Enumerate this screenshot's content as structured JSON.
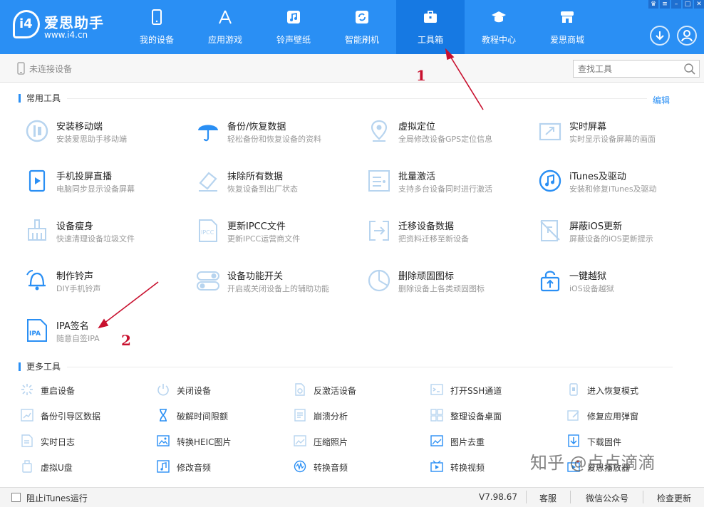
{
  "app": {
    "logo_name": "爱思助手",
    "logo_url": "www.i4.cn",
    "logo_badge": "i4",
    "accent": "#2a8ff4",
    "active_nav_bg": "#1679e3"
  },
  "nav": [
    {
      "label": "我的设备",
      "icon": "phone-icon"
    },
    {
      "label": "应用游戏",
      "icon": "app-store-icon"
    },
    {
      "label": "铃声壁纸",
      "icon": "music-icon"
    },
    {
      "label": "智能刷机",
      "icon": "refresh-icon"
    },
    {
      "label": "工具箱",
      "icon": "toolbox-icon",
      "active": true
    },
    {
      "label": "教程中心",
      "icon": "graduation-cap-icon"
    },
    {
      "label": "爱思商城",
      "icon": "store-icon"
    }
  ],
  "device_status": "未连接设备",
  "search": {
    "placeholder": "查找工具"
  },
  "common_tools": {
    "title": "常用工具",
    "edit": "编辑",
    "items": [
      {
        "name": "安装移动端",
        "desc": "安装爱思助手移动端",
        "icon": "install-mobile-icon"
      },
      {
        "name": "备份/恢复数据",
        "desc": "轻松备份和恢复设备的资料",
        "icon": "umbrella-icon"
      },
      {
        "name": "虚拟定位",
        "desc": "全局修改设备GPS定位信息",
        "icon": "location-pin-icon"
      },
      {
        "name": "实时屏幕",
        "desc": "实时显示设备屏幕的画面",
        "icon": "screen-icon"
      },
      {
        "name": "手机投屏直播",
        "desc": "电脑同步显示设备屏幕",
        "icon": "play-screen-icon"
      },
      {
        "name": "抹除所有数据",
        "desc": "恢复设备到出厂状态",
        "icon": "eraser-icon"
      },
      {
        "name": "批量激活",
        "desc": "支持多台设备同时进行激活",
        "icon": "batch-activate-icon"
      },
      {
        "name": "iTunes及驱动",
        "desc": "安装和修复iTunes及驱动",
        "icon": "itunes-icon"
      },
      {
        "name": "设备瘦身",
        "desc": "快速清理设备垃圾文件",
        "icon": "broom-icon"
      },
      {
        "name": "更新IPCC文件",
        "desc": "更新IPCC运营商文件",
        "icon": "ipcc-file-icon"
      },
      {
        "name": "迁移设备数据",
        "desc": "把资料迁移至新设备",
        "icon": "migrate-icon"
      },
      {
        "name": "屏蔽iOS更新",
        "desc": "屏蔽设备的iOS更新提示",
        "icon": "block-update-icon"
      },
      {
        "name": "制作铃声",
        "desc": "DIY手机铃声",
        "icon": "bell-icon"
      },
      {
        "name": "设备功能开关",
        "desc": "开启或关闭设备上的辅助功能",
        "icon": "toggle-icon"
      },
      {
        "name": "删除顽固图标",
        "desc": "删除设备上各类顽固图标",
        "icon": "pie-icon"
      },
      {
        "name": "一键越狱",
        "desc": "iOS设备越狱",
        "icon": "unlock-icon"
      },
      {
        "name": "IPA签名",
        "desc": "随意自签IPA",
        "icon": "ipa-file-icon"
      }
    ]
  },
  "more_tools": {
    "title": "更多工具",
    "items": [
      {
        "name": "重启设备",
        "icon": "restart-icon"
      },
      {
        "name": "关闭设备",
        "icon": "power-icon"
      },
      {
        "name": "反激活设备",
        "icon": "deactivate-icon"
      },
      {
        "name": "打开SSH通道",
        "icon": "terminal-icon"
      },
      {
        "name": "进入恢复模式",
        "icon": "recovery-icon"
      },
      {
        "name": "备份引导区数据",
        "icon": "backup-boot-icon"
      },
      {
        "name": "破解时间限额",
        "icon": "hourglass-icon"
      },
      {
        "name": "崩溃分析",
        "icon": "crash-log-icon"
      },
      {
        "name": "整理设备桌面",
        "icon": "grid-icon"
      },
      {
        "name": "修复应用弹窗",
        "icon": "fix-popup-icon"
      },
      {
        "name": "实时日志",
        "icon": "log-icon"
      },
      {
        "name": "转换HEIC图片",
        "icon": "heic-image-icon"
      },
      {
        "name": "压缩照片",
        "icon": "compress-photo-icon"
      },
      {
        "name": "图片去重",
        "icon": "dedupe-image-icon"
      },
      {
        "name": "下载固件",
        "icon": "download-firmware-icon"
      },
      {
        "name": "虚拟U盘",
        "icon": "usb-drive-icon"
      },
      {
        "name": "修改音频",
        "icon": "audio-edit-icon"
      },
      {
        "name": "转换音频",
        "icon": "audio-convert-icon"
      },
      {
        "name": "转换视频",
        "icon": "video-convert-icon"
      },
      {
        "name": "爱思播放器",
        "icon": "player-icon"
      }
    ]
  },
  "footer": {
    "itunes_label": "阻止iTunes运行",
    "version": "V7.98.67",
    "service": "客服",
    "wechat": "微信公众号",
    "check_update": "检查更新"
  },
  "annotations": {
    "step1": "1",
    "step2": "2",
    "color": "#c8102e"
  },
  "watermark": "知乎 @点点滴滴"
}
